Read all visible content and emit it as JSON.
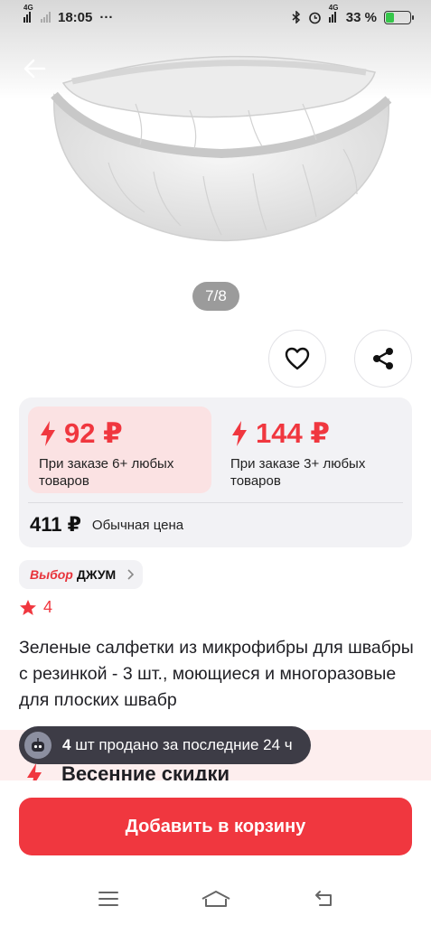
{
  "status_bar": {
    "network_left": "4G",
    "time": "18:05",
    "more": "···",
    "network_right": "4G",
    "battery_percent": "33 %",
    "battery_level": 0.33
  },
  "gallery": {
    "counter": "7/8"
  },
  "prices": {
    "tier1": {
      "value": "92 ₽",
      "condition": "При заказе 6+ любых товаров"
    },
    "tier2": {
      "value": "144 ₽",
      "condition": "При заказе 3+ любых товаров"
    },
    "regular": {
      "value": "411 ₽",
      "label": "Обычная цена"
    }
  },
  "badge": {
    "brand": "Выбор",
    "name": "ДЖУМ"
  },
  "rating": {
    "value": "4"
  },
  "product": {
    "title": "Зеленые салфетки из микрофибры для швабры с резинкой - 3 шт., моющиеся и многоразовые для плоских швабр"
  },
  "sold_notice": {
    "count": "4",
    "text": " шт продано за последние 24 ч"
  },
  "promo": {
    "title": "Весенние скидки"
  },
  "actions": {
    "add_to_cart": "Добавить в корзину"
  },
  "colors": {
    "accent": "#f0373f",
    "tier_highlight": "#fbe2e3",
    "card_bg": "#f2f2f5",
    "toast_bg": "#3d3c46"
  },
  "icons": {
    "back": "arrow-left-icon",
    "favorite": "heart-icon",
    "share": "share-icon",
    "bolt": "lightning-icon",
    "star": "star-icon",
    "menu": "menu-icon",
    "home": "home-icon",
    "return": "back-nav-icon"
  }
}
